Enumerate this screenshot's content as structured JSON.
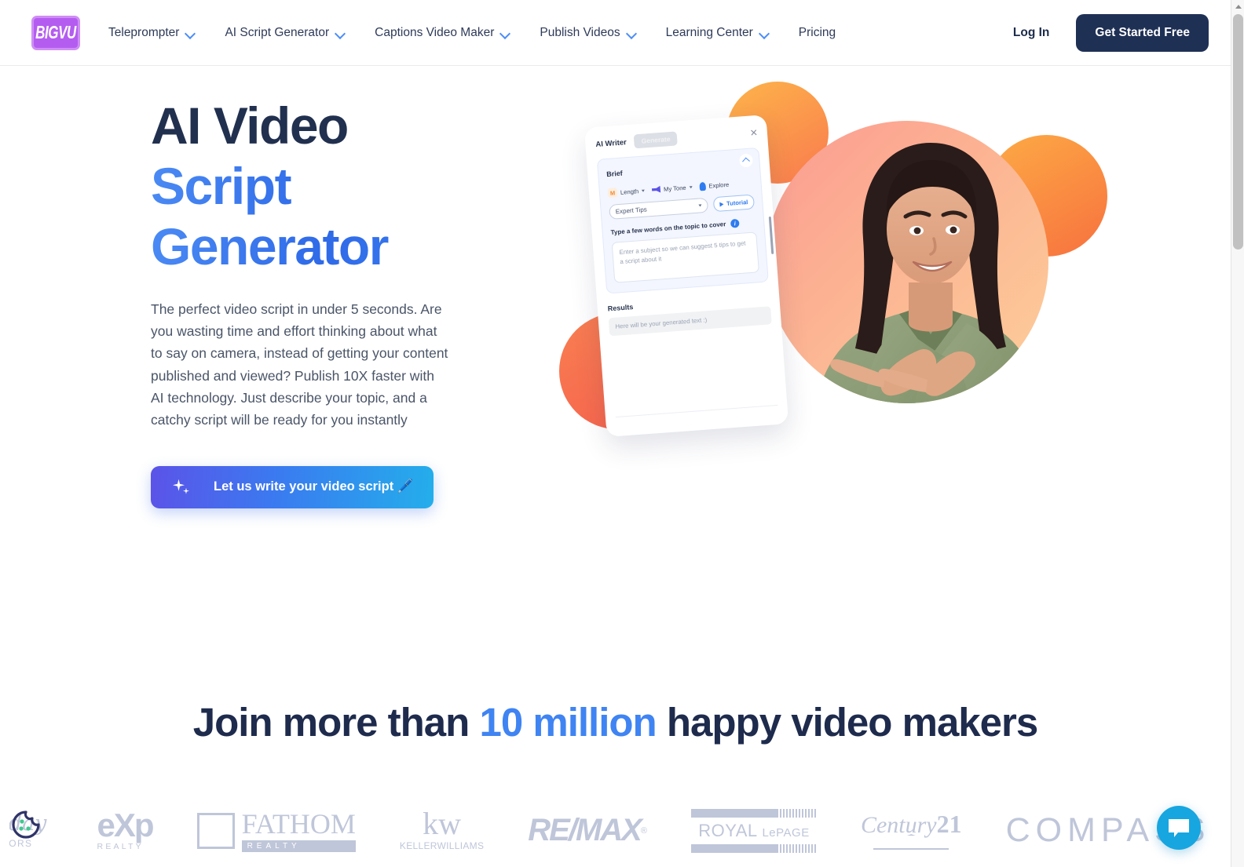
{
  "header": {
    "logo_text": "BIGVU",
    "nav": [
      {
        "label": "Teleprompter",
        "has_dropdown": true
      },
      {
        "label": "AI Script Generator",
        "has_dropdown": true
      },
      {
        "label": "Captions Video Maker",
        "has_dropdown": true
      },
      {
        "label": "Publish Videos",
        "has_dropdown": true
      },
      {
        "label": "Learning Center",
        "has_dropdown": true
      },
      {
        "label": "Pricing",
        "has_dropdown": false
      }
    ],
    "login_label": "Log In",
    "cta_label": "Get Started Free"
  },
  "hero": {
    "title_line1": "AI Video",
    "title_line2": "Script",
    "title_line3": "Generator",
    "paragraph": "The perfect video script in under 5 seconds. Are you wasting time and effort thinking about what to say on camera, instead of getting your content published and viewed? Publish 10X faster with AI technology. Just describe your topic, and a catchy script will be ready for you instantly",
    "button_label": "Let us write your video script 🖊️"
  },
  "app_card": {
    "title": "AI Writer",
    "generate_label": "Generate",
    "brief_label": "Brief",
    "length_badge": "M",
    "length_label": "Length",
    "tone_label": "My Tone",
    "explore_label": "Explore",
    "select_value": "Expert Tips",
    "tutorial_label": "Tutorial",
    "topic_label": "Type a few words on the topic to cover",
    "topic_placeholder": "Enter a subject so we can suggest 5 tips to get a script about it",
    "results_label": "Results",
    "results_placeholder": "Here will be your generated text :)"
  },
  "social": {
    "heading_part1": "Join more than ",
    "heading_highlight": "10 million",
    "heading_part2": " happy video makers",
    "highlight_color": "#3f84f2",
    "logos": [
      {
        "name": "holiday-realtors",
        "script": "liday",
        "sub": "LTORS"
      },
      {
        "name": "exp-realty",
        "main": "eXp",
        "sub": "REALTY"
      },
      {
        "name": "fathom-realty",
        "main": "FATHOM",
        "sub": "REALTY"
      },
      {
        "name": "keller-williams",
        "main": "kw",
        "sub": "KELLERWILLIAMS"
      },
      {
        "name": "remax",
        "main": "RE/MAX",
        "sub": "®"
      },
      {
        "name": "royal-lepage",
        "main": "ROYAL",
        "sub": "LePAGE"
      },
      {
        "name": "century-21",
        "main": "Century",
        "sub": "21"
      },
      {
        "name": "compass",
        "main": "COMPASS",
        "sub": ""
      }
    ]
  },
  "widgets": {
    "cookie_icon": "cookie-icon",
    "chat_icon": "chat-bubble-icon",
    "cookie_outline_color": "#2f3469",
    "cookie_dot_color": "#3ec88f",
    "chat_color": "#17a6e0"
  }
}
